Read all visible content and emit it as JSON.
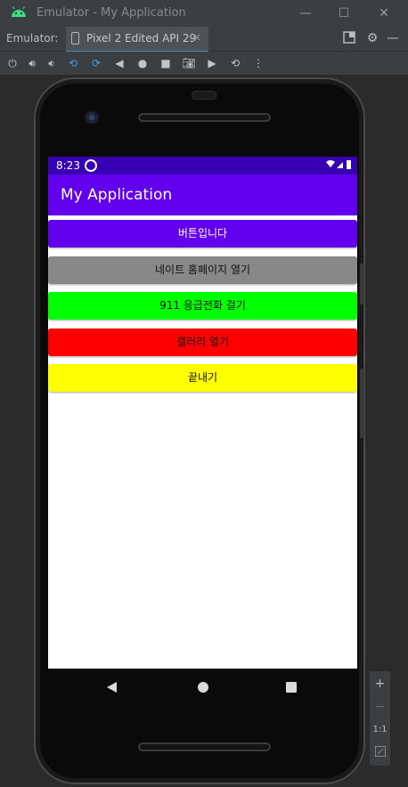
{
  "window": {
    "title": "Emulator - My Application",
    "minimize_icon": "minimize-icon",
    "maximize_icon": "maximize-icon",
    "close_icon": "close-icon"
  },
  "tabbar": {
    "label": "Emulator:",
    "tab_label": "Pixel 2 Edited API 29",
    "tab_close": "×"
  },
  "toolbar": {
    "icons": [
      "power-icon",
      "volume-up-icon",
      "volume-down-icon",
      "rotate-left-icon",
      "rotate-right-icon",
      "back-icon",
      "home-icon",
      "overview-icon",
      "camera-icon",
      "screenrecord-icon",
      "snapshot-icon",
      "more-icon"
    ]
  },
  "device": {
    "status": {
      "time": "8:23",
      "icons": "▾◢▮"
    },
    "app_title": "My Application",
    "buttons": [
      {
        "label": "버튼입니다",
        "color": "#6200ee",
        "text_color": "#ffffff"
      },
      {
        "label": "네이트 홈페이지 열기",
        "color": "#888888",
        "text_color": "#111111"
      },
      {
        "label": "911 응급전화 걸기",
        "color": "#00ff00",
        "text_color": "#111111"
      },
      {
        "label": "갤러리 열기",
        "color": "#ff0000",
        "text_color": "#111111"
      },
      {
        "label": "끝내기",
        "color": "#ffff00",
        "text_color": "#111111"
      }
    ]
  },
  "zoom": {
    "plus": "+",
    "minus": "−",
    "one_to_one": "1:1"
  },
  "colors": {
    "status_bar": "#3700b3",
    "app_bar": "#6200ee"
  }
}
